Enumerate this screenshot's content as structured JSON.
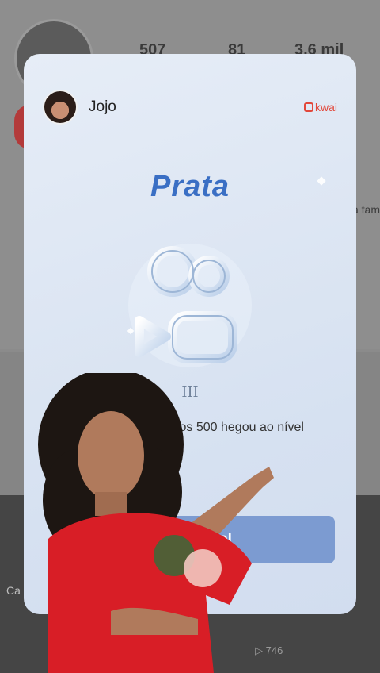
{
  "background": {
    "stats": [
      "507",
      "81",
      "3,6 mil"
    ],
    "side_text": "a fam",
    "caption_fragment": "Ca",
    "video_views": "746"
  },
  "modal": {
    "user_name": "Jojo",
    "brand": "kwai",
    "level_title": "Prata",
    "level_roman": "III",
    "message": "onseguiu seus primeiros 500 hegou ao nível Prata III.",
    "button_label": "vo nível"
  },
  "colors": {
    "accent_blue": "#3a6fc4",
    "button_blue": "#7c9bd1",
    "kwai_red": "#e2483b"
  }
}
